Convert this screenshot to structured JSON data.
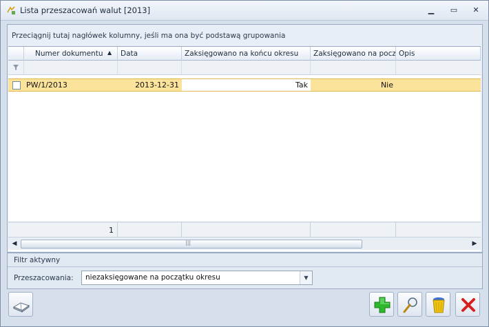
{
  "window": {
    "title": "Lista przeszacowań walut [2013]",
    "controls": {
      "minimize": "▁",
      "restore": "▭",
      "close": "✕"
    }
  },
  "grid": {
    "group_hint": "Przeciągnij tutaj nagłówek kolumny, jeśli ma ona być podstawą grupowania",
    "columns": [
      "Numer dokumentu",
      "Data",
      "Zaksięgowano na końcu okresu",
      "Zaksięgowano na pocz...",
      "Opis"
    ],
    "sort_indicator": "▲",
    "filter_icon": "funnel-icon",
    "rows": [
      {
        "numer": "PW/1/2013",
        "data": "2013-12-31",
        "koniec": "Tak",
        "poczatek": "Nie",
        "opis": ""
      }
    ],
    "footer_count": "1",
    "scroll": {
      "left": "◀",
      "right": "▶",
      "grip": "|||"
    }
  },
  "filter": {
    "title": "Filtr aktywny",
    "label": "Przeszacowania:",
    "value": "niezaksięgowane na początku okresu",
    "arrow": "▼"
  },
  "toolbar": {
    "icons": [
      "book-icon",
      "add-icon",
      "magnifier-icon",
      "trash-icon",
      "cancel-icon"
    ]
  },
  "colors": {
    "selected_row": "#fbe39b",
    "add": "#2db82d",
    "cancel": "#d62020",
    "trash": "#f1c40f"
  }
}
